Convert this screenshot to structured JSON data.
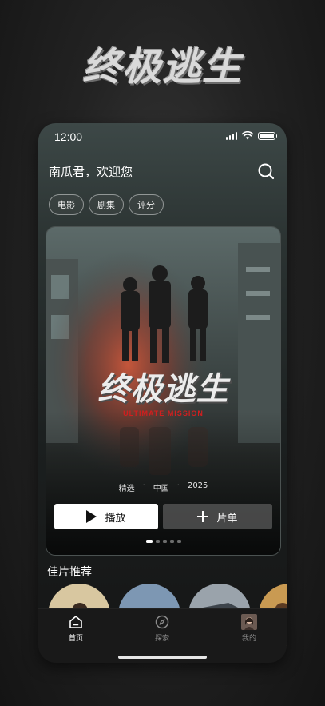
{
  "promo": {
    "title": "终极逃生"
  },
  "status_bar": {
    "time": "12:00"
  },
  "header": {
    "greeting": "南瓜君，欢迎您"
  },
  "chips": [
    "电影",
    "剧集",
    "评分"
  ],
  "hero": {
    "title": "终极逃生",
    "subtitle": "ULTIMATE MISSION",
    "meta": [
      "精选",
      "中国",
      "2025"
    ],
    "play_label": "播放",
    "list_label": "片单",
    "carousel": {
      "count": 5,
      "active_index": 0
    }
  },
  "recommend": {
    "title": "佳片推荐"
  },
  "tabbar": {
    "items": [
      {
        "label": "首页",
        "icon": "home-icon",
        "active": true
      },
      {
        "label": "探索",
        "icon": "compass-icon",
        "active": false
      },
      {
        "label": "我的",
        "icon": "avatar",
        "active": false
      }
    ]
  },
  "colors": {
    "accent_red": "#d11f1f",
    "button_light": "#ffffff",
    "tabbar_bg": "#191919"
  }
}
